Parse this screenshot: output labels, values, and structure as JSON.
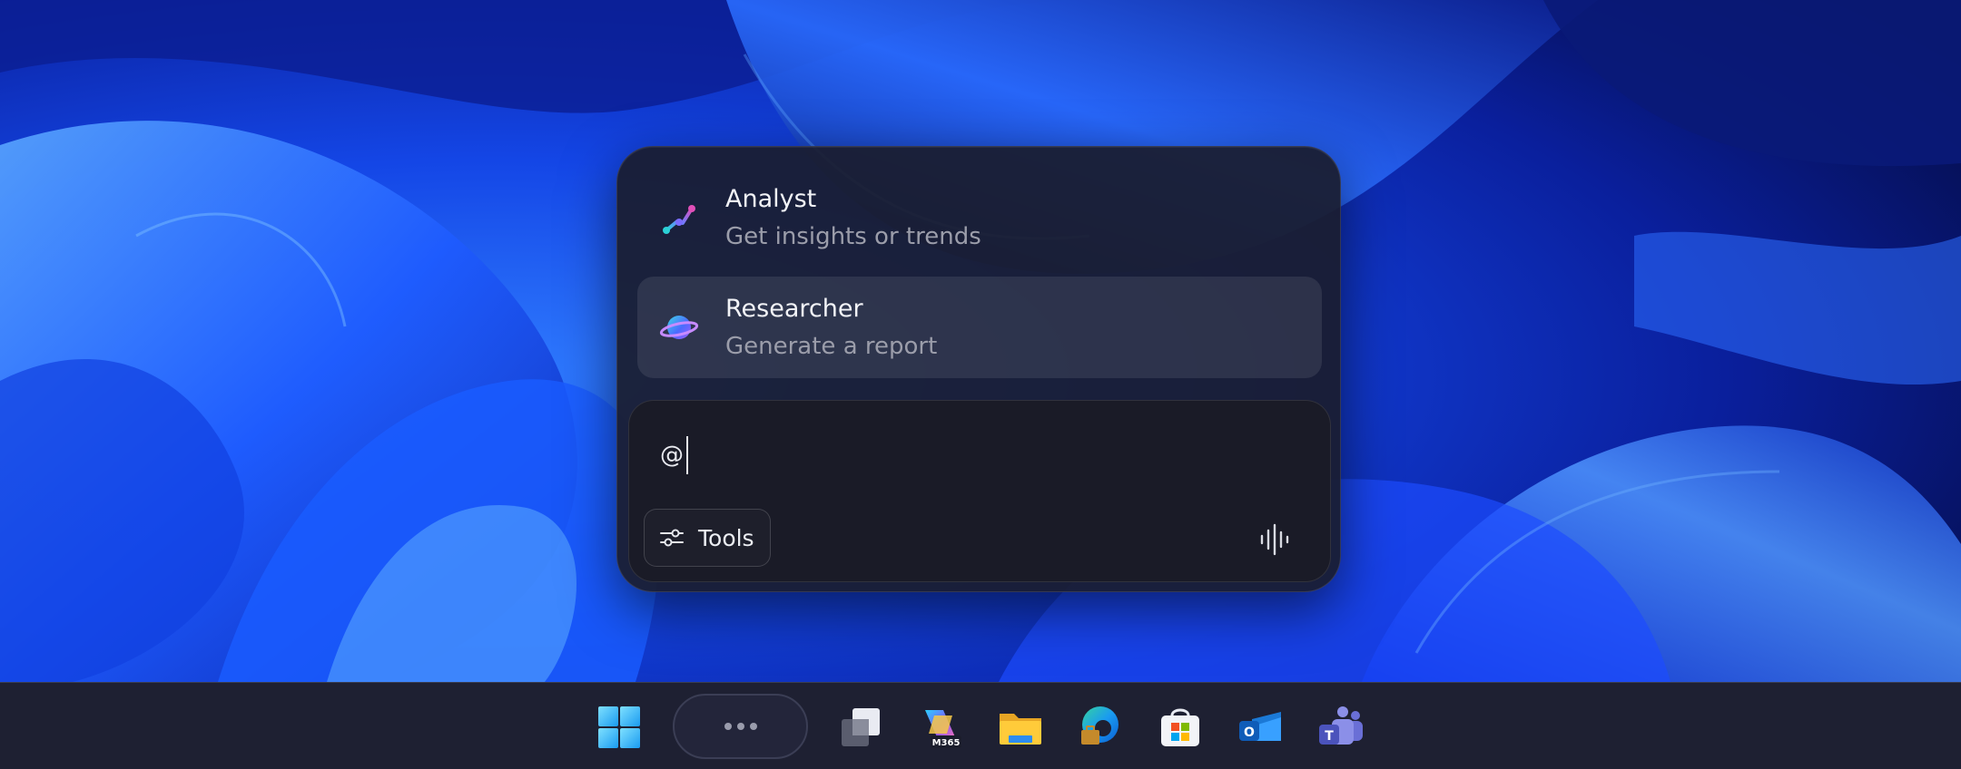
{
  "copilot": {
    "agents": [
      {
        "title": "Analyst",
        "subtitle": "Get insights or trends",
        "icon": "analyst-icon",
        "selected": false
      },
      {
        "title": "Researcher",
        "subtitle": "Generate a report",
        "icon": "researcher-icon",
        "selected": true
      }
    ],
    "composer": {
      "value": "@",
      "tools_label": "Tools",
      "tools_icon": "sliders-icon",
      "voice_icon": "voice-waveform-icon"
    }
  },
  "taskbar": {
    "pinned": [
      {
        "name": "start",
        "icon": "windows-start-icon"
      },
      {
        "name": "search-pill",
        "icon": "ellipsis-icon"
      },
      {
        "name": "task-view",
        "icon": "task-view-icon"
      },
      {
        "name": "microsoft-365-copilot",
        "icon": "m365-copilot-icon",
        "badge": "M365"
      },
      {
        "name": "file-explorer",
        "icon": "folder-icon"
      },
      {
        "name": "edge",
        "icon": "edge-icon"
      },
      {
        "name": "microsoft-store",
        "icon": "store-icon"
      },
      {
        "name": "outlook",
        "icon": "outlook-icon",
        "badge": "O"
      },
      {
        "name": "teams",
        "icon": "teams-icon",
        "badge": "T"
      }
    ]
  },
  "colors": {
    "panel_bg": "#1a1c2c",
    "selected_row": "#34364a",
    "taskbar_bg": "#1e2032",
    "wallpaper_blue": "#1a4dff"
  }
}
